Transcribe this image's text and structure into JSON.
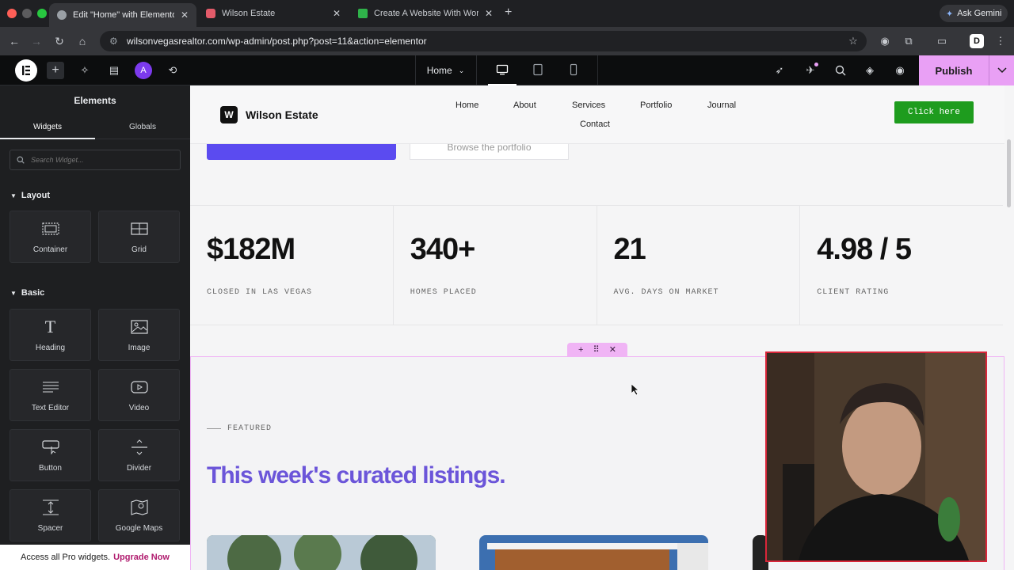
{
  "browser": {
    "tabs": [
      {
        "title": "Edit \"Home\" with Elementor",
        "active": true
      },
      {
        "title": "Wilson Estate",
        "active": false
      },
      {
        "title": "Create A Website With WordPress",
        "active": false
      }
    ],
    "gemini_label": "Ask Gemini",
    "url": "wilsonvegasrealtor.com/wp-admin/post.php?post=11&action=elementor",
    "profile_initial": "D"
  },
  "editor": {
    "page_name": "Home",
    "publish_label": "Publish",
    "accent": "#e9a0f5"
  },
  "panel": {
    "title": "Elements",
    "tabs": [
      "Widgets",
      "Globals"
    ],
    "search_placeholder": "Search Widget...",
    "categories": [
      {
        "name": "Layout",
        "widgets": [
          {
            "label": "Container",
            "icon": "container-icon"
          },
          {
            "label": "Grid",
            "icon": "grid-icon"
          }
        ]
      },
      {
        "name": "Basic",
        "widgets": [
          {
            "label": "Heading",
            "icon": "heading-icon"
          },
          {
            "label": "Image",
            "icon": "image-icon"
          },
          {
            "label": "Text Editor",
            "icon": "text-editor-icon"
          },
          {
            "label": "Video",
            "icon": "video-icon"
          },
          {
            "label": "Button",
            "icon": "button-icon"
          },
          {
            "label": "Divider",
            "icon": "divider-icon"
          },
          {
            "label": "Spacer",
            "icon": "spacer-icon"
          },
          {
            "label": "Google Maps",
            "icon": "google-maps-icon"
          }
        ]
      }
    ],
    "pro_text": "Access all Pro widgets.",
    "pro_link": "Upgrade Now"
  },
  "site": {
    "logo_letter": "W",
    "name": "Wilson Estate",
    "menu": [
      "Home",
      "About",
      "Services",
      "Portfolio",
      "Journal",
      "Contact"
    ],
    "cta": "Click here",
    "cta_color": "#1e9c1e",
    "hero_secondary_btn": "Browse the portfolio",
    "stats": [
      {
        "value": "$182M",
        "label": "CLOSED IN LAS VEGAS"
      },
      {
        "value": "340+",
        "label": "HOMES PLACED"
      },
      {
        "value": "21",
        "label": "AVG. DAYS ON MARKET"
      },
      {
        "value": "4.98 / 5",
        "label": "CLIENT RATING"
      }
    ],
    "featured_eyebrow": "FEATURED",
    "featured_headline": "This week's curated listings.",
    "headline_color": "#6b55d9"
  }
}
